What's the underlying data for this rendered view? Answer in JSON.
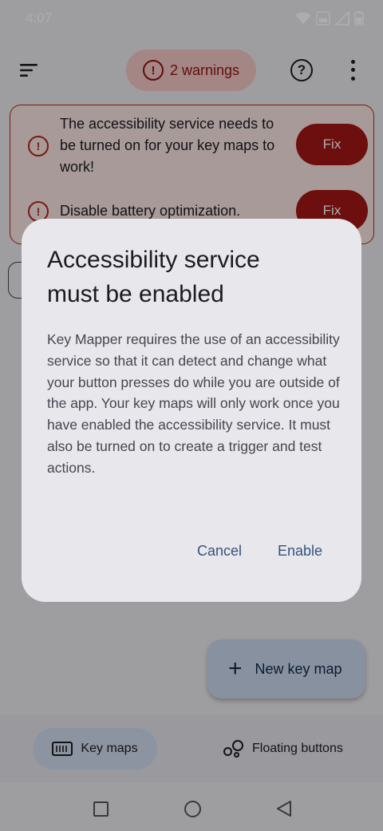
{
  "status_bar": {
    "time": "4:07",
    "icons": [
      "wifi-icon",
      "volte-icon",
      "signal-icon",
      "battery-icon"
    ]
  },
  "top_bar": {
    "warnings_label": "2 warnings",
    "warning_icon_glyph": "!",
    "help_glyph": "?"
  },
  "warnings": [
    {
      "text": "The accessibility service needs to be turned on for your key maps to work!",
      "fix_label": "Fix"
    },
    {
      "text": "Disable battery optimization.",
      "fix_label": "Fix"
    }
  ],
  "fab": {
    "label": "New key map"
  },
  "bottom_nav": {
    "items": [
      {
        "label": "Key maps",
        "active": true
      },
      {
        "label": "Floating buttons",
        "active": false
      }
    ]
  },
  "dialog": {
    "title": "Accessibility service must be enabled",
    "body": "Key Mapper requires the use of an accessibility service so that it can detect and change what your button presses do while you are outside of the app. Your key maps will only work once you have enabled the accessibility service. It must also be turned on to create a trigger and test actions.",
    "cancel_label": "Cancel",
    "enable_label": "Enable"
  },
  "colors": {
    "error": "#b3261e",
    "fix_button": "#a31717",
    "primary_text_button": "#36547d",
    "fab": "#c9d6ea"
  }
}
